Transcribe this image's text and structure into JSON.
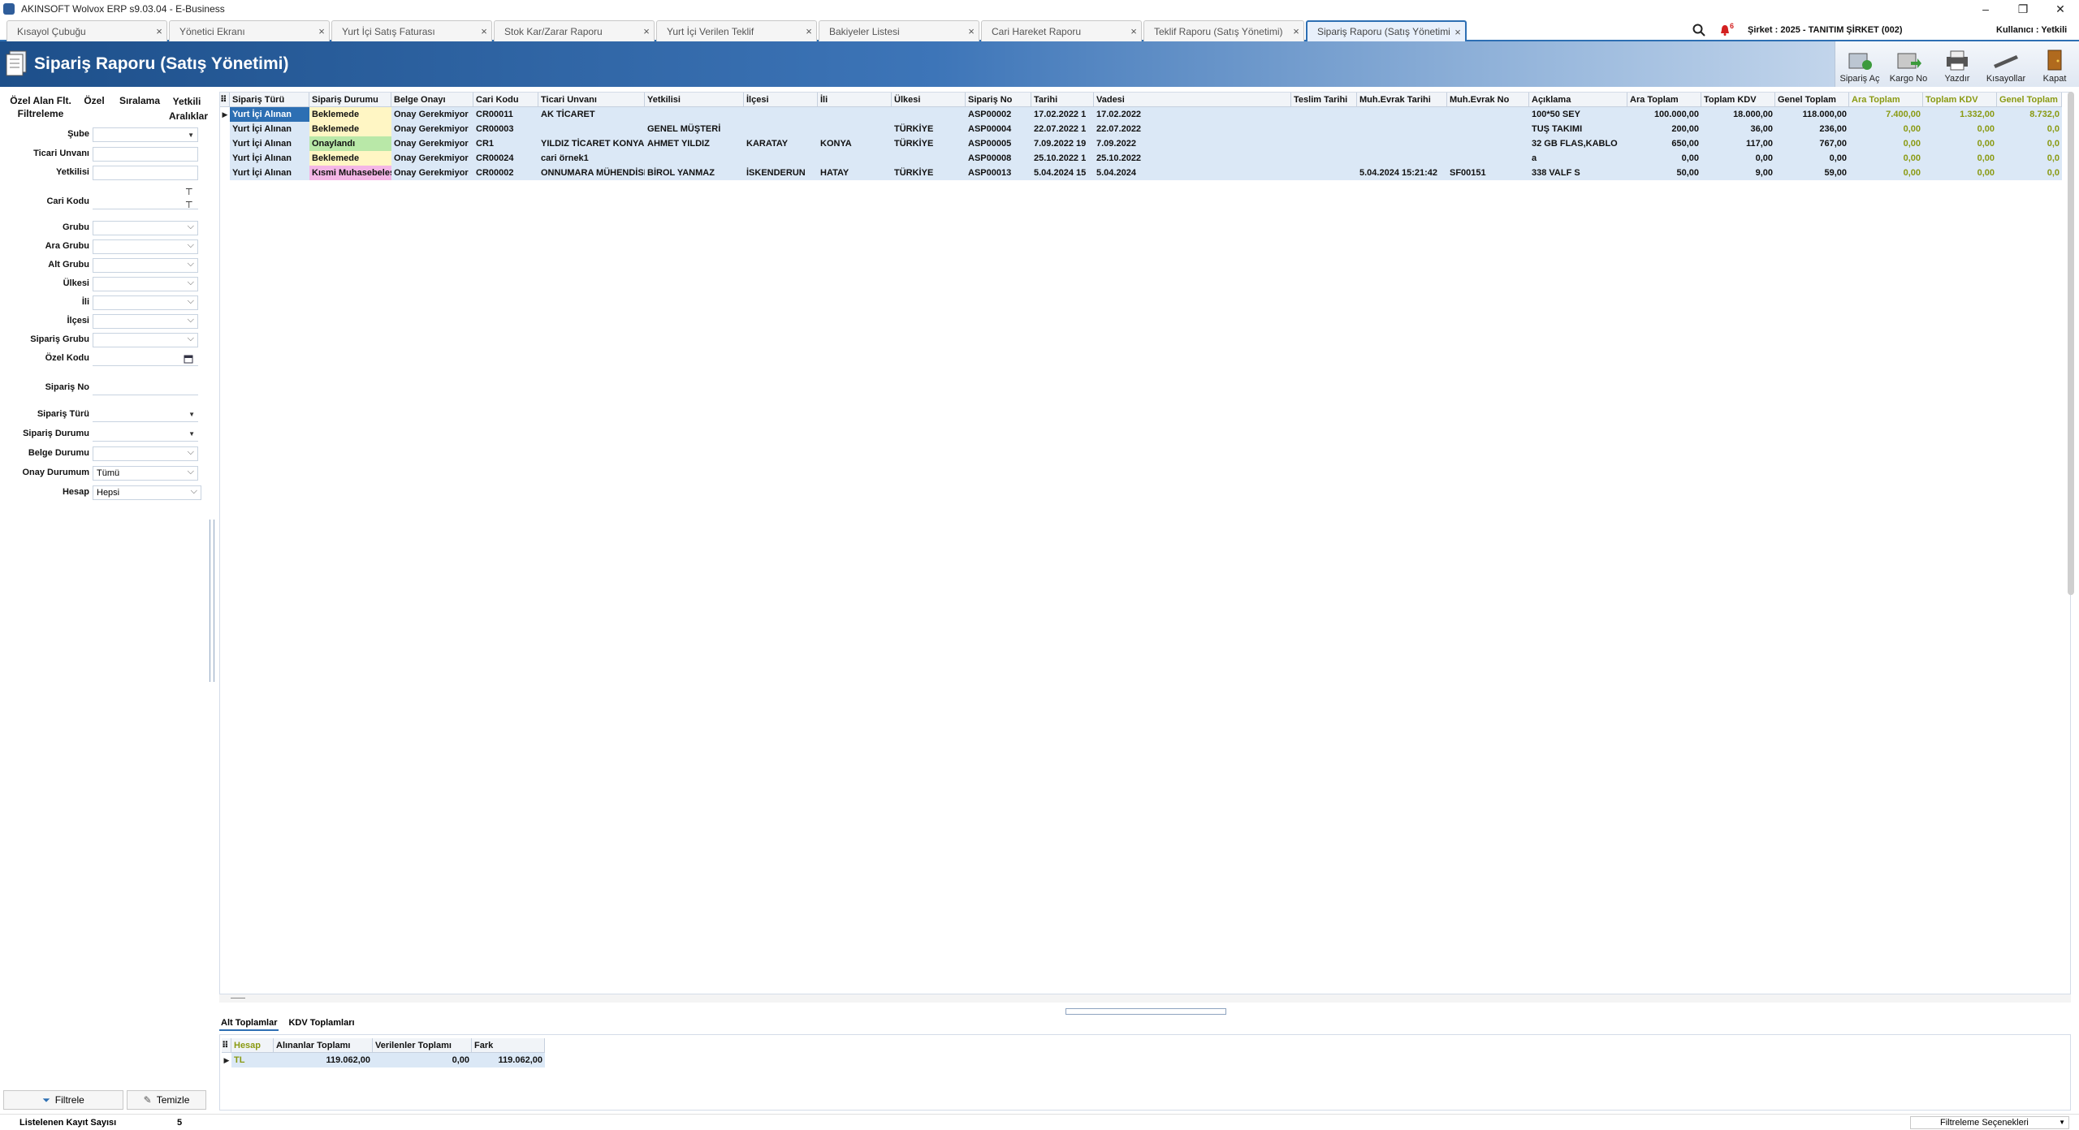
{
  "app": {
    "title": "AKINSOFT Wolvox ERP s9.03.04 - E-Business"
  },
  "tabs": [
    {
      "label": "Kısayol Çubuğu"
    },
    {
      "label": "Yönetici Ekranı"
    },
    {
      "label": "Yurt İçi Satış Faturası"
    },
    {
      "label": "Stok Kar/Zarar Raporu"
    },
    {
      "label": "Yurt İçi Verilen Teklif"
    },
    {
      "label": "Bakiyeler Listesi"
    },
    {
      "label": "Cari Hareket Raporu"
    },
    {
      "label": "Teklif Raporu (Satış Yönetimi)"
    },
    {
      "label": "Sipariş Raporu (Satış Yönetimi)"
    }
  ],
  "topright": {
    "notif_count": "6",
    "company": "Şirket : 2025 - TANITIM ŞİRKET (002)",
    "user": "Kullanıcı : Yetkili"
  },
  "header": {
    "title": "Sipariş Raporu (Satış Yönetimi)"
  },
  "toolbar": [
    {
      "label": "Sipariş Aç"
    },
    {
      "label": "Kargo No"
    },
    {
      "label": "Yazdır"
    },
    {
      "label": "Kısayollar"
    },
    {
      "label": "Kapat"
    }
  ],
  "filter_tabs": {
    "custom_filter": "Özel Alan Flt.",
    "filtering": "Filtreleme",
    "special": "Özel",
    "sorting": "Sıralama",
    "authority_ranges": "Yetkili Aralıklar"
  },
  "filters": [
    {
      "label": "Şube",
      "value": ""
    },
    {
      "label": "Ticari Unvanı",
      "value": ""
    },
    {
      "label": "Yetkilisi",
      "value": ""
    },
    {
      "label": "Cari Kodu",
      "value": ""
    },
    {
      "label": "Grubu",
      "value": ""
    },
    {
      "label": "Ara Grubu",
      "value": ""
    },
    {
      "label": "Alt Grubu",
      "value": ""
    },
    {
      "label": "Ülkesi",
      "value": ""
    },
    {
      "label": "İli",
      "value": ""
    },
    {
      "label": "İlçesi",
      "value": ""
    },
    {
      "label": "Sipariş Grubu",
      "value": ""
    },
    {
      "label": "Özel Kodu",
      "value": ""
    },
    {
      "label": "Sipariş No",
      "value": ""
    },
    {
      "label": "Sipariş Türü",
      "value": ""
    },
    {
      "label": "Sipariş Durumu",
      "value": ""
    },
    {
      "label": "Belge Durumu",
      "value": ""
    },
    {
      "label": "Onay Durumum",
      "value": "Tümü"
    },
    {
      "label": "Hesap",
      "value": "Hepsi"
    }
  ],
  "buttons": {
    "filter": "Filtrele",
    "clear": "Temizle"
  },
  "grid": {
    "columns": [
      "Sipariş Türü",
      "Sipariş Durumu",
      "Belge Onayı",
      "Cari Kodu",
      "Ticari Unvanı",
      "Yetkilisi",
      "İlçesi",
      "İli",
      "Ülkesi",
      "Sipariş No",
      "Tarihi",
      "Vadesi",
      "Teslim Tarihi",
      "Muh.Evrak Tarihi",
      "Muh.Evrak No",
      "Açıklama",
      "Ara Toplam",
      "Toplam KDV",
      "Genel Toplam",
      "Ara Toplam",
      "Toplam KDV",
      "Genel Toplam"
    ],
    "rows": [
      [
        "Yurt İçi Alınan",
        "Beklemede",
        "Onay Gerekmiyor",
        "CR00011",
        "AK TİCARET",
        "",
        "",
        "",
        "",
        "ASP00002",
        "17.02.2022 1",
        "17.02.2022",
        "",
        "",
        "",
        "100*50 SEY",
        "100.000,00",
        "18.000,00",
        "118.000,00",
        "7.400,00",
        "1.332,00",
        "8.732,0"
      ],
      [
        "Yurt İçi Alınan",
        "Beklemede",
        "Onay Gerekmiyor",
        "CR00003",
        "",
        "GENEL MÜŞTERİ",
        "",
        "",
        "TÜRKİYE",
        "ASP00004",
        "22.07.2022 1",
        "22.07.2022",
        "",
        "",
        "",
        "TUŞ TAKIMI",
        "200,00",
        "36,00",
        "236,00",
        "0,00",
        "0,00",
        "0,0"
      ],
      [
        "Yurt İçi Alınan",
        "Onaylandı",
        "Onay Gerekmiyor",
        "CR1",
        "YILDIZ TİCARET KONYA",
        "AHMET YILDIZ",
        "KARATAY",
        "KONYA",
        "TÜRKİYE",
        "ASP00005",
        "7.09.2022 19",
        "7.09.2022",
        "",
        "",
        "",
        "32 GB FLAS,KABLO",
        "650,00",
        "117,00",
        "767,00",
        "0,00",
        "0,00",
        "0,0"
      ],
      [
        "Yurt İçi Alınan",
        "Beklemede",
        "Onay Gerekmiyor",
        "CR00024",
        "cari örnek1",
        "",
        "",
        "",
        "",
        "ASP00008",
        "25.10.2022 1",
        "25.10.2022",
        "",
        "",
        "",
        "a",
        "0,00",
        "0,00",
        "0,00",
        "0,00",
        "0,00",
        "0,0"
      ],
      [
        "Yurt İçi Alınan",
        "Kısmi Muhasebeleşti",
        "Onay Gerekmiyor",
        "CR00002",
        "ONNUMARA MÜHENDİSLİK",
        "BİROL YANMAZ",
        "İSKENDERUN",
        "HATAY",
        "TÜRKİYE",
        "ASP00013",
        "5.04.2024 15",
        "5.04.2024",
        "",
        "5.04.2024 15:21:42",
        "SF00151",
        "338 VALF S",
        "50,00",
        "9,00",
        "59,00",
        "0,00",
        "0,00",
        "0,0"
      ]
    ]
  },
  "bottom_tabs": [
    "Alt Toplamlar",
    "KDV Toplamları"
  ],
  "bottom_grid": {
    "columns": [
      "Hesap",
      "Alınanlar Toplamı",
      "Verilenler Toplamı",
      "Fark"
    ],
    "rows": [
      [
        "TL",
        "119.062,00",
        "0,00",
        "119.062,00"
      ]
    ]
  },
  "status": {
    "label": "Listelenen Kayıt Sayısı",
    "count": "5",
    "options": "Filtreleme Seçenekleri"
  },
  "colors": {
    "accent": "#2d6fb3",
    "row_bg": "#dbe8f6",
    "waiting": "#fff6c4",
    "approved": "#b9e8a8",
    "partial": "#f4b6e6",
    "subtotal_text": "#8a9a12"
  },
  "icons": [
    "search-icon",
    "bell-icon",
    "report-icon",
    "open-order-icon",
    "cargo-icon",
    "print-icon",
    "shortcuts-icon",
    "exit-icon",
    "filter-icon",
    "clear-icon",
    "calendar-icon",
    "pin-icon"
  ]
}
